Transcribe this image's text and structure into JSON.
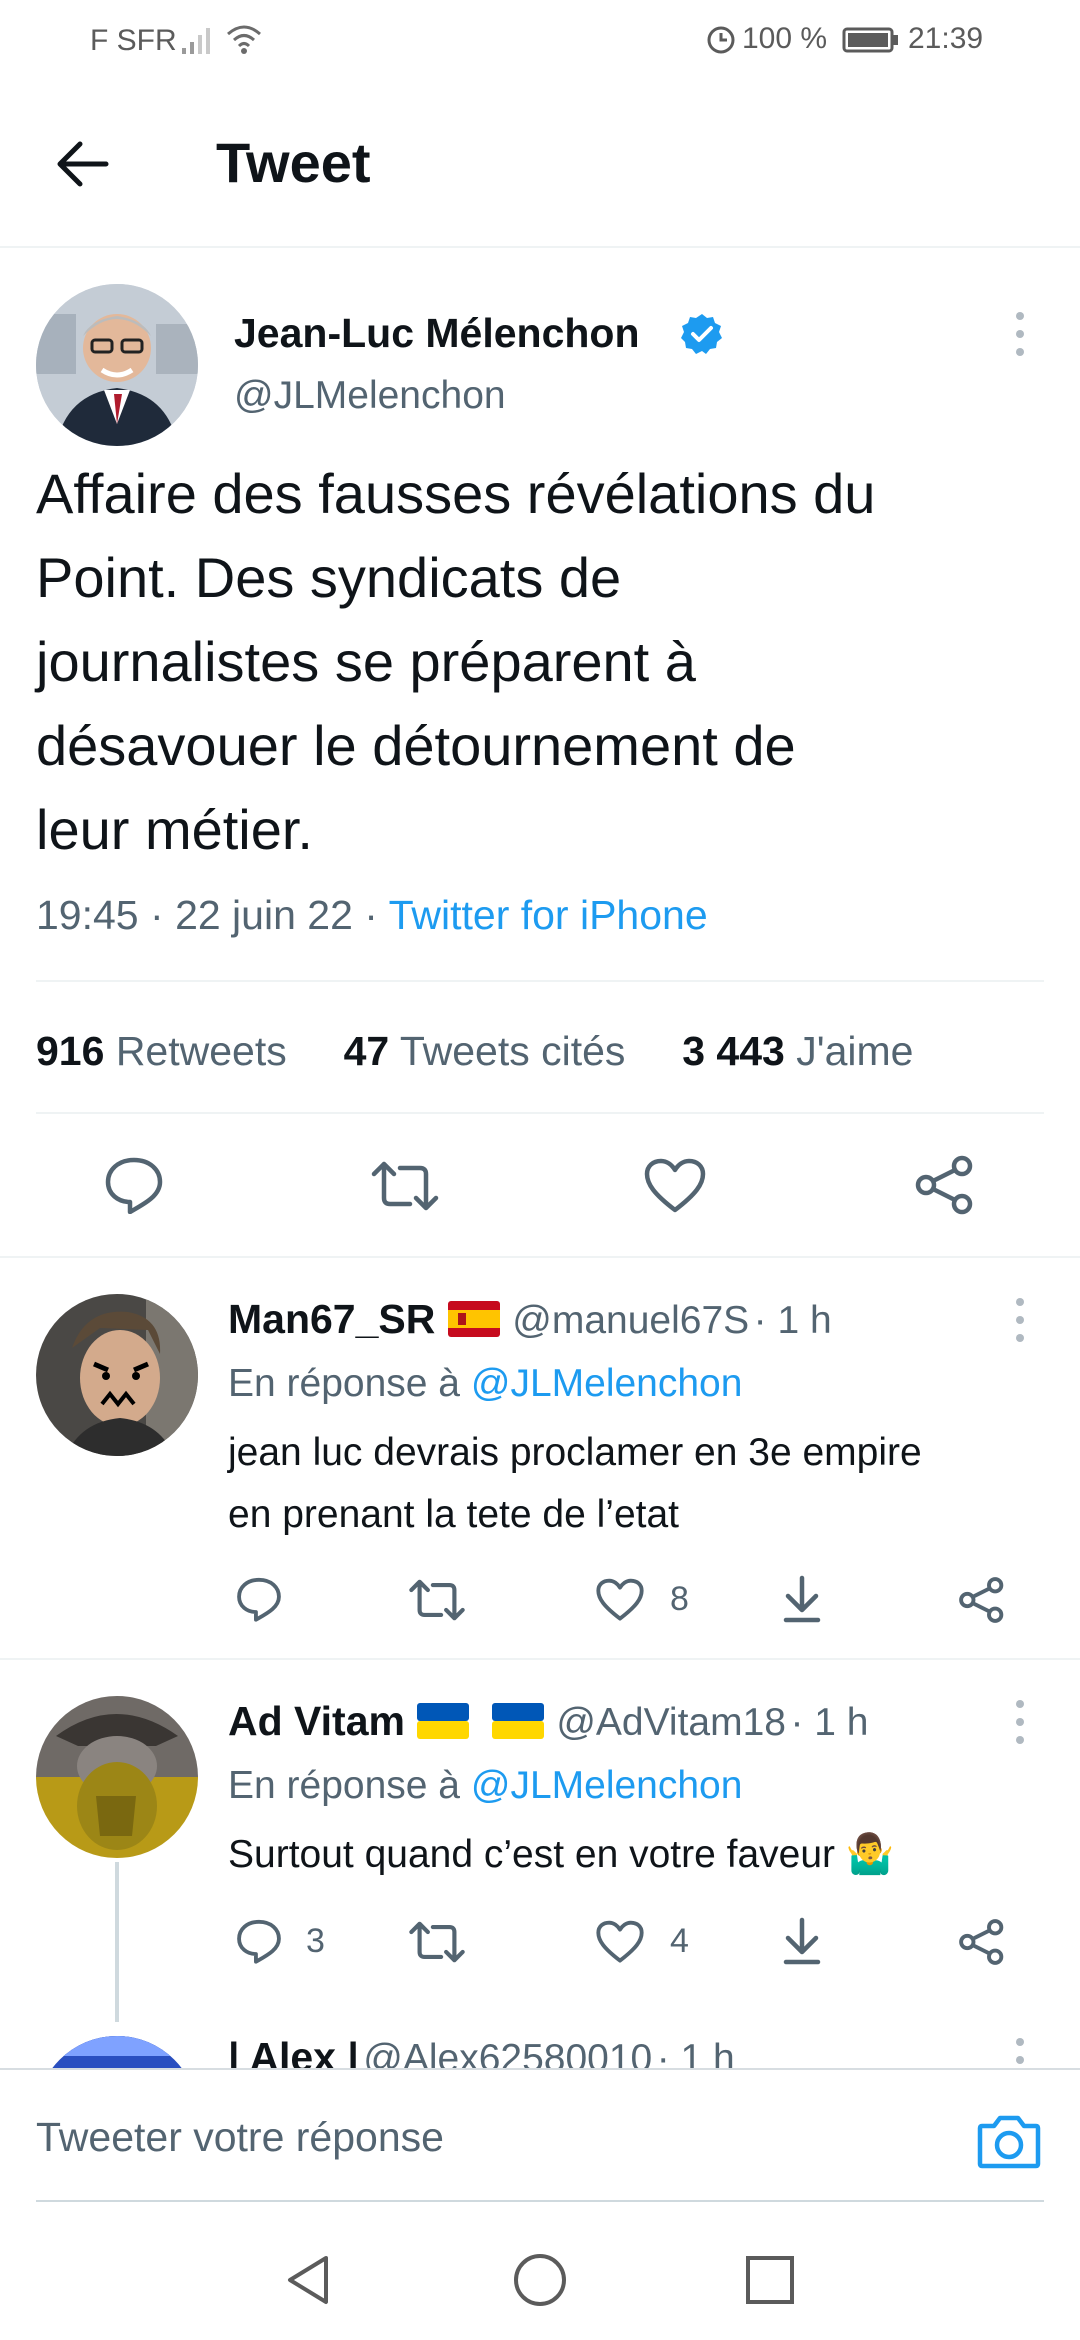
{
  "status_bar": {
    "carrier": "F SFR",
    "battery": "100 %",
    "time": "21:39"
  },
  "header": {
    "title": "Tweet"
  },
  "tweet": {
    "author_name": "Jean-Luc Mélenchon",
    "author_handle": "@JLMelenchon",
    "verified": true,
    "text_lines": [
      "Affaire des fausses révélations du",
      "Point. Des syndicats de",
      "journalistes se préparent à",
      "désavouer le détournement de",
      "leur métier."
    ],
    "time": "19:45",
    "date": "22 juin 22",
    "source": "Twitter for iPhone",
    "stats": {
      "retweets_count": "916",
      "retweets_label": "Retweets",
      "quotes_count": "47",
      "quotes_label": "Tweets cités",
      "likes_count": "3 443",
      "likes_label": "J'aime"
    }
  },
  "replies": [
    {
      "name": "Man67_SR",
      "handle": "@manuel67S",
      "time": "· 1 h",
      "reply_prefix": "En réponse à",
      "reply_to": "@JLMelenchon",
      "text_lines": [
        "jean luc devrais proclamer en 3e empire",
        "en prenant la tete de l’etat"
      ],
      "reply_count": "",
      "retweet_count": "",
      "like_count": "8"
    },
    {
      "name": "Ad Vitam",
      "handle": "@AdVitam18",
      "time": "· 1 h",
      "reply_prefix": "En réponse à",
      "reply_to": "@JLMelenchon",
      "text_lines": [
        "Surtout quand c’est en votre faveur 🤷‍♂️"
      ],
      "reply_count": "3",
      "retweet_count": "",
      "like_count": "4"
    },
    {
      "name": "| Alex |",
      "handle": "@Alex62580010",
      "time": "· 1 h"
    }
  ],
  "composer": {
    "placeholder": "Tweeter votre réponse"
  },
  "colors": {
    "accent": "#1d9bf0",
    "text": "#0f1419",
    "secondary": "#536471"
  }
}
